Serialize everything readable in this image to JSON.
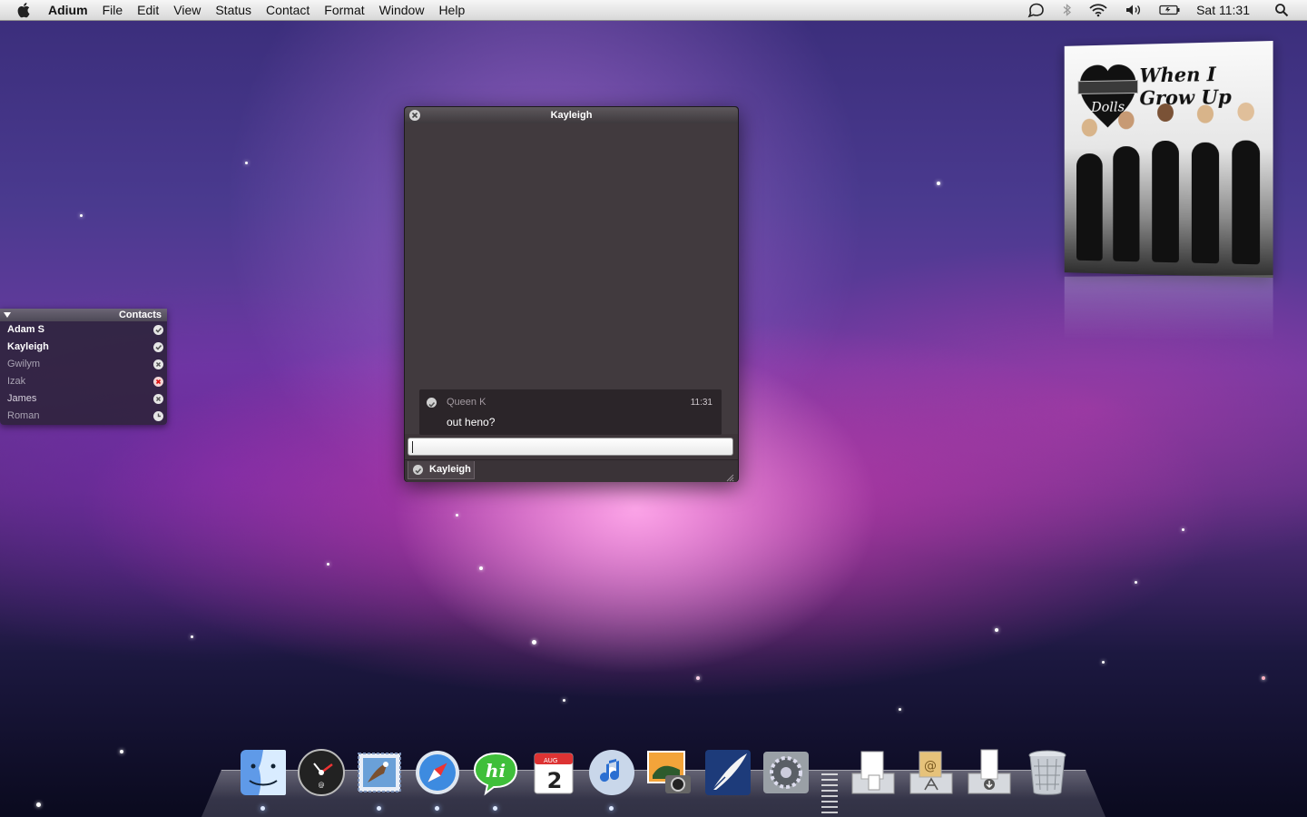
{
  "menubar": {
    "app_name": "Adium",
    "items": [
      "File",
      "Edit",
      "View",
      "Status",
      "Contact",
      "Format",
      "Window",
      "Help"
    ],
    "clock": "Sat 11:31",
    "status_icons": [
      "adium-duck-icon",
      "bluetooth-icon",
      "wifi-icon",
      "volume-icon",
      "battery-icon",
      "spotlight-icon"
    ]
  },
  "contacts": {
    "title": "Contacts",
    "items": [
      {
        "name": "Adam S",
        "status": "available"
      },
      {
        "name": "Kayleigh",
        "status": "available"
      },
      {
        "name": "Gwilym",
        "status": "offline"
      },
      {
        "name": "Izak",
        "status": "busy"
      },
      {
        "name": "James",
        "status": "offline"
      },
      {
        "name": "Roman",
        "status": "idle"
      }
    ]
  },
  "chat": {
    "title": "Kayleigh",
    "message": {
      "sender": "Queen K",
      "time": "11:31",
      "text": "out heno?"
    },
    "input_value": "",
    "tab_label": "Kayleigh"
  },
  "album": {
    "band": "Dolls",
    "title": "When I Grow Up"
  },
  "dock": {
    "apps": [
      "finder-icon",
      "dashboard-icon",
      "mail-icon",
      "safari-icon",
      "hi-chat-icon",
      "ical-icon",
      "itunes-icon",
      "iphoto-icon",
      "quill-icon",
      "system-preferences-icon",
      "documents-stack-icon",
      "applications-stack-icon",
      "downloads-stack-icon",
      "trash-icon"
    ],
    "ical": {
      "month": "AUG",
      "day": "2"
    }
  },
  "colors": {
    "accent_pink": "#e85ec9",
    "chat_bg": "#413a3e",
    "menubar_bg": "#e6e6e6"
  }
}
